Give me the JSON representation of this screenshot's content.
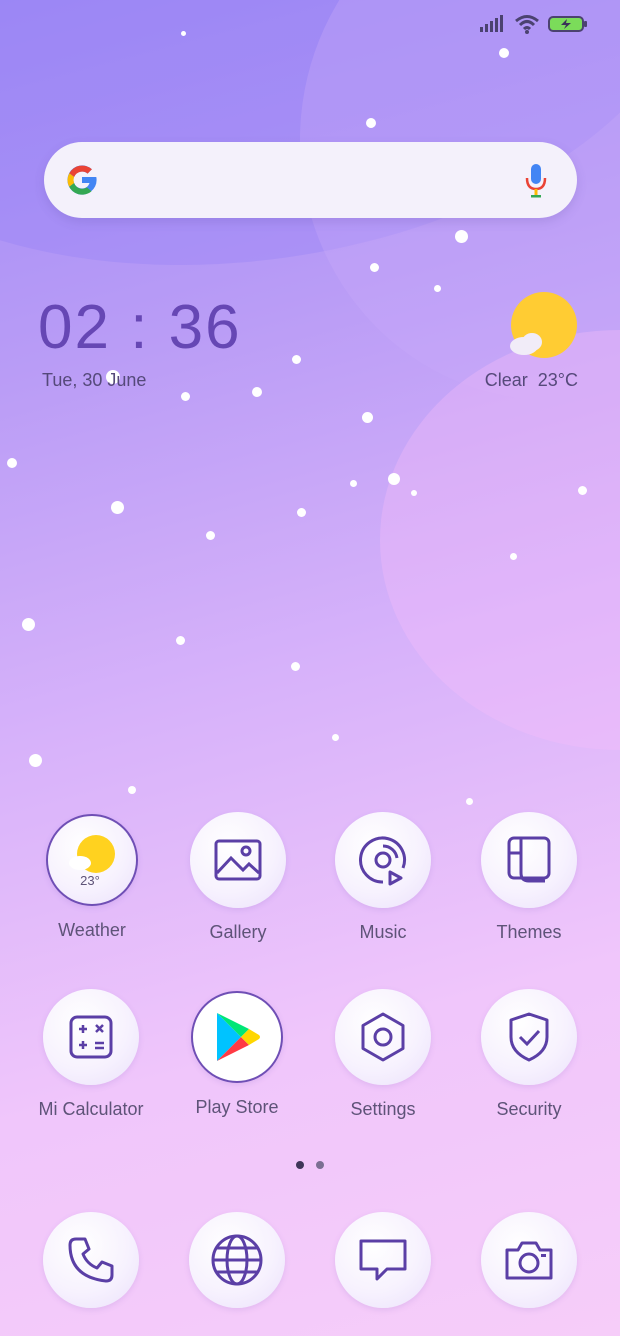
{
  "status_bar": {
    "signal": "signal-icon",
    "wifi": "wifi-icon",
    "battery": "battery-charging-icon"
  },
  "search": {
    "logo": "google-g-icon",
    "mic": "mic-icon"
  },
  "clock": {
    "time": "02 : 36",
    "date": "Tue, 30 June"
  },
  "weather_widget": {
    "icon": "sun-cloud-icon",
    "condition": "Clear",
    "temp": "23°C"
  },
  "apps": [
    {
      "label": "Weather",
      "icon": "weather-icon",
      "badge": "23°"
    },
    {
      "label": "Gallery",
      "icon": "gallery-icon"
    },
    {
      "label": "Music",
      "icon": "music-icon"
    },
    {
      "label": "Themes",
      "icon": "themes-icon"
    },
    {
      "label": "Mi Calculator",
      "icon": "calculator-icon"
    },
    {
      "label": "Play Store",
      "icon": "play-store-icon"
    },
    {
      "label": "Settings",
      "icon": "settings-icon"
    },
    {
      "label": "Security",
      "icon": "security-shield-icon"
    }
  ],
  "dock": [
    {
      "icon": "phone-icon"
    },
    {
      "icon": "browser-globe-icon"
    },
    {
      "icon": "messages-icon"
    },
    {
      "icon": "camera-icon"
    }
  ],
  "pager": {
    "current_page": 1,
    "total_pages": 2
  },
  "colors": {
    "accent": "#5b3fa6",
    "sun": "#ffcc33",
    "text": "#5e5378"
  }
}
